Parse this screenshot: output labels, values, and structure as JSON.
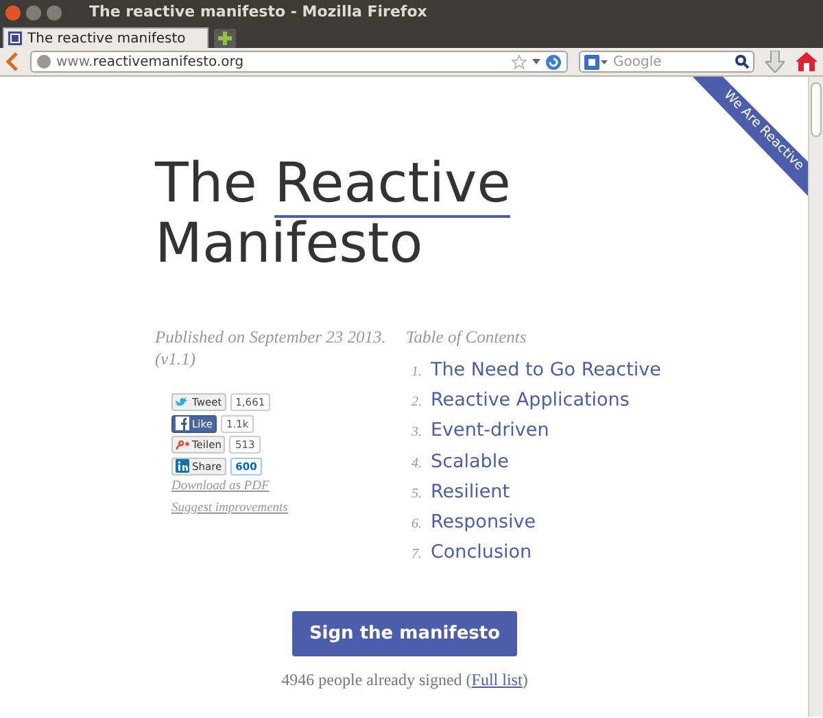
{
  "window": {
    "title": "The reactive manifesto - Mozilla Firefox"
  },
  "tabs": [
    {
      "title": "The reactive manifesto",
      "selected": true
    }
  ],
  "toolbar": {
    "url_prefix": "www.",
    "url_domain": "reactivemanifesto.org",
    "search_placeholder": "Google"
  },
  "ribbon": "We Are Reactive",
  "title": [
    {
      "text": "The",
      "underlined": false
    },
    {
      "text": "Reactive",
      "underlined": true
    },
    {
      "text": "Manifesto",
      "underlined": false
    }
  ],
  "published": "Published on September 23 2013. (v1.1)",
  "social": [
    {
      "kind": "twitter",
      "label": "Tweet",
      "count": "1,661"
    },
    {
      "kind": "facebook",
      "label": "Like",
      "count": "1.1k"
    },
    {
      "kind": "google",
      "label": "Teilen",
      "count": "513"
    },
    {
      "kind": "linkedin",
      "label": "Share",
      "count": "600"
    }
  ],
  "links": [
    "Download as PDF",
    "Suggest improvements"
  ],
  "toc": {
    "heading": "Table of Contents",
    "items": [
      {
        "number": "1.",
        "label": "The Need to Go Reactive"
      },
      {
        "number": "2.",
        "label": "Reactive Applications"
      },
      {
        "number": "3.",
        "label": "Event-driven"
      },
      {
        "number": "4.",
        "label": "Scalable"
      },
      {
        "number": "5.",
        "label": "Resilient"
      },
      {
        "number": "6.",
        "label": "Responsive"
      },
      {
        "number": "7.",
        "label": "Conclusion"
      }
    ]
  },
  "sign_button": "Sign the manifesto",
  "signed": {
    "text": "4946 people already signed (",
    "link": "Full list",
    "after": ")"
  }
}
